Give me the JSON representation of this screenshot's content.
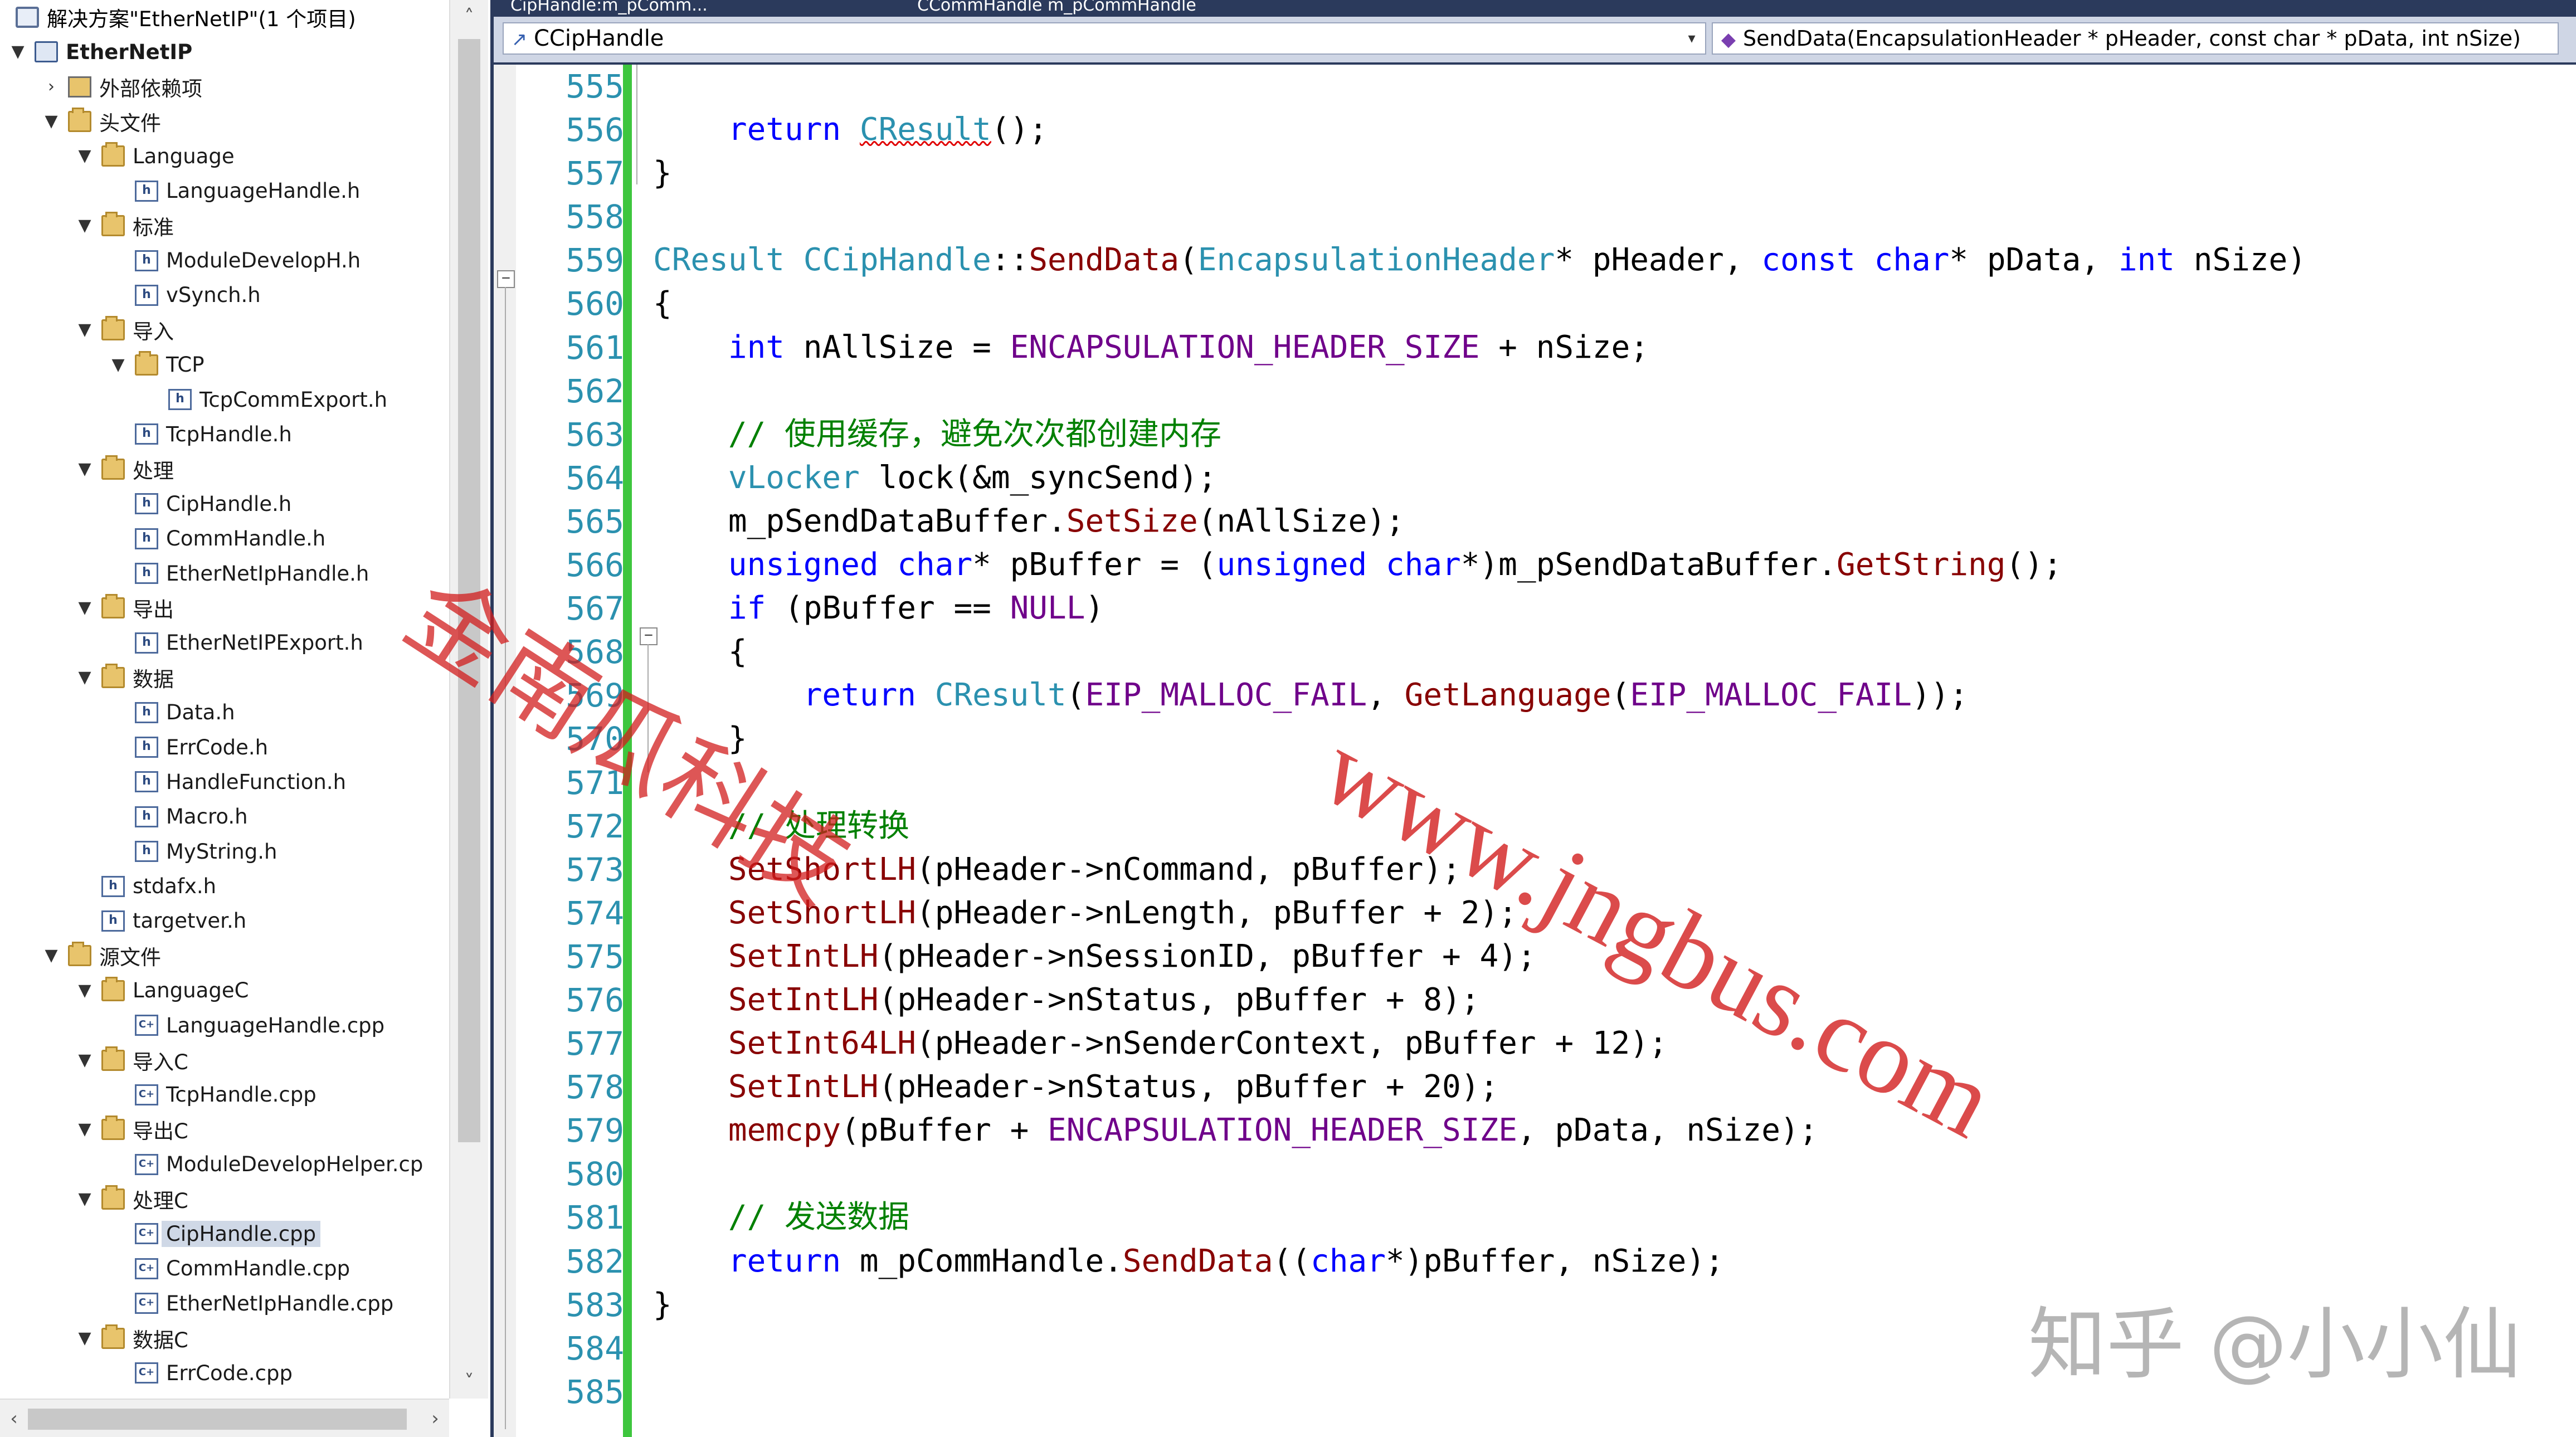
{
  "explorer": {
    "header": "解决方案\"EtherNetIP\"(1 个项目)",
    "rows": [
      {
        "label": "EtherNetIP",
        "level": 0,
        "arrow": "▼",
        "icon": "proj",
        "bold": true
      },
      {
        "label": "外部依赖项",
        "level": 1,
        "arrow": "›",
        "icon": "ext"
      },
      {
        "label": "头文件",
        "level": 1,
        "arrow": "▼",
        "icon": "folder"
      },
      {
        "label": "Language",
        "level": 2,
        "arrow": "▼",
        "icon": "folder"
      },
      {
        "label": "LanguageHandle.h",
        "level": 3,
        "icon": "h"
      },
      {
        "label": "标准",
        "level": 2,
        "arrow": "▼",
        "icon": "folder"
      },
      {
        "label": "ModuleDevelopH.h",
        "level": 3,
        "icon": "h"
      },
      {
        "label": "vSynch.h",
        "level": 3,
        "icon": "h"
      },
      {
        "label": "导入",
        "level": 2,
        "arrow": "▼",
        "icon": "folder"
      },
      {
        "label": "TCP",
        "level": 3,
        "arrow": "▼",
        "icon": "folder"
      },
      {
        "label": "TcpCommExport.h",
        "level": 4,
        "icon": "h"
      },
      {
        "label": "TcpHandle.h",
        "level": 3,
        "icon": "h"
      },
      {
        "label": "处理",
        "level": 2,
        "arrow": "▼",
        "icon": "folder"
      },
      {
        "label": "CipHandle.h",
        "level": 3,
        "icon": "h"
      },
      {
        "label": "CommHandle.h",
        "level": 3,
        "icon": "h"
      },
      {
        "label": "EtherNetIpHandle.h",
        "level": 3,
        "icon": "h"
      },
      {
        "label": "导出",
        "level": 2,
        "arrow": "▼",
        "icon": "folder"
      },
      {
        "label": "EtherNetIPExport.h",
        "level": 3,
        "icon": "h"
      },
      {
        "label": "数据",
        "level": 2,
        "arrow": "▼",
        "icon": "folder"
      },
      {
        "label": "Data.h",
        "level": 3,
        "icon": "h"
      },
      {
        "label": "ErrCode.h",
        "level": 3,
        "icon": "h"
      },
      {
        "label": "HandleFunction.h",
        "level": 3,
        "icon": "h"
      },
      {
        "label": "Macro.h",
        "level": 3,
        "icon": "h"
      },
      {
        "label": "MyString.h",
        "level": 3,
        "icon": "h"
      },
      {
        "label": "stdafx.h",
        "level": 2,
        "icon": "h"
      },
      {
        "label": "targetver.h",
        "level": 2,
        "icon": "h"
      },
      {
        "label": "源文件",
        "level": 1,
        "arrow": "▼",
        "icon": "folder"
      },
      {
        "label": "LanguageC",
        "level": 2,
        "arrow": "▼",
        "icon": "folder"
      },
      {
        "label": "LanguageHandle.cpp",
        "level": 3,
        "icon": "cpp"
      },
      {
        "label": "导入C",
        "level": 2,
        "arrow": "▼",
        "icon": "folder"
      },
      {
        "label": "TcpHandle.cpp",
        "level": 3,
        "icon": "cpp"
      },
      {
        "label": "导出C",
        "level": 2,
        "arrow": "▼",
        "icon": "folder"
      },
      {
        "label": "ModuleDevelopHelper.cp",
        "level": 3,
        "icon": "cpp"
      },
      {
        "label": "处理C",
        "level": 2,
        "arrow": "▼",
        "icon": "folder"
      },
      {
        "label": "CipHandle.cpp",
        "level": 3,
        "icon": "cpp",
        "selected": true
      },
      {
        "label": "CommHandle.cpp",
        "level": 3,
        "icon": "cpp"
      },
      {
        "label": "EtherNetIpHandle.cpp",
        "level": 3,
        "icon": "cpp"
      },
      {
        "label": "数据C",
        "level": 2,
        "arrow": "▼",
        "icon": "folder"
      },
      {
        "label": "ErrCode.cpp",
        "level": 3,
        "icon": "cpp"
      }
    ]
  },
  "tabs": [
    {
      "label": "CipHandle:m_pComm..."
    },
    {
      "label": "CCommHandle m_pCommHandle"
    }
  ],
  "nav": {
    "class_combo": "CCipHandle",
    "member_combo": "SendData(EncapsulationHeader * pHeader, const char * pData, int nSize)"
  },
  "line_numbers": [
    "555",
    "556",
    "557",
    "558",
    "559",
    "560",
    "561",
    "562",
    "563",
    "564",
    "565",
    "566",
    "567",
    "568",
    "569",
    "570",
    "571",
    "572",
    "573",
    "574",
    "575",
    "576",
    "577",
    "578",
    "579",
    "580",
    "581",
    "582",
    "583",
    "584",
    "585"
  ],
  "code_lines": [
    [],
    [
      [
        "    ",
        "p"
      ],
      [
        "return",
        "kw"
      ],
      [
        " ",
        "p"
      ],
      [
        "CResult",
        "ty sq"
      ],
      [
        "();",
        "p"
      ]
    ],
    [
      [
        "}",
        "p"
      ]
    ],
    [],
    [
      [
        "CResult",
        "ty"
      ],
      [
        " ",
        "p"
      ],
      [
        "CCipHandle",
        "ty"
      ],
      [
        "::",
        "p"
      ],
      [
        "SendData",
        "fn"
      ],
      [
        "(",
        "p"
      ],
      [
        "EncapsulationHeader",
        "ty"
      ],
      [
        "* pHeader, ",
        "p"
      ],
      [
        "const",
        "kw"
      ],
      [
        " ",
        "p"
      ],
      [
        "char",
        "kw"
      ],
      [
        "* pData, ",
        "p"
      ],
      [
        "int",
        "kw"
      ],
      [
        " nSize)",
        "p"
      ]
    ],
    [
      [
        "{",
        "p"
      ]
    ],
    [
      [
        "    ",
        "p"
      ],
      [
        "int",
        "kw"
      ],
      [
        " nAllSize = ",
        "p"
      ],
      [
        "ENCAPSULATION_HEADER_SIZE",
        "mc"
      ],
      [
        " + nSize;",
        "p"
      ]
    ],
    [],
    [
      [
        "    ",
        "p"
      ],
      [
        "// 使用缓存，避免次次都创建内存",
        "cm"
      ]
    ],
    [
      [
        "    ",
        "p"
      ],
      [
        "vLocker",
        "ty"
      ],
      [
        " lock(&m_syncSend);",
        "p"
      ]
    ],
    [
      [
        "    m_pSendDataBuffer.",
        "p"
      ],
      [
        "SetSize",
        "fn"
      ],
      [
        "(nAllSize);",
        "p"
      ]
    ],
    [
      [
        "    ",
        "p"
      ],
      [
        "unsigned",
        "kw"
      ],
      [
        " ",
        "p"
      ],
      [
        "char",
        "kw"
      ],
      [
        "* pBuffer = (",
        "p"
      ],
      [
        "unsigned",
        "kw"
      ],
      [
        " ",
        "p"
      ],
      [
        "char",
        "kw"
      ],
      [
        "*)m_pSendDataBuffer.",
        "p"
      ],
      [
        "GetString",
        "fn"
      ],
      [
        "();",
        "p"
      ]
    ],
    [
      [
        "    ",
        "p"
      ],
      [
        "if",
        "kw"
      ],
      [
        " (pBuffer == ",
        "p"
      ],
      [
        "NULL",
        "mc"
      ],
      [
        ")",
        "p"
      ]
    ],
    [
      [
        "    {",
        "p"
      ]
    ],
    [
      [
        "        ",
        "p"
      ],
      [
        "return",
        "kw"
      ],
      [
        " ",
        "p"
      ],
      [
        "CResult",
        "ty"
      ],
      [
        "(",
        "p"
      ],
      [
        "EIP_MALLOC_FAIL",
        "mc"
      ],
      [
        ", ",
        "p"
      ],
      [
        "GetLanguage",
        "fn"
      ],
      [
        "(",
        "p"
      ],
      [
        "EIP_MALLOC_FAIL",
        "mc"
      ],
      [
        "));",
        "p"
      ]
    ],
    [
      [
        "    }",
        "p"
      ]
    ],
    [],
    [
      [
        "    ",
        "p"
      ],
      [
        "// 处理转换",
        "cm"
      ]
    ],
    [
      [
        "    ",
        "p"
      ],
      [
        "SetShortLH",
        "fn"
      ],
      [
        "(pHeader->nCommand, pBuffer);",
        "p"
      ]
    ],
    [
      [
        "    ",
        "p"
      ],
      [
        "SetShortLH",
        "fn"
      ],
      [
        "(pHeader->nLength, pBuffer + 2);",
        "p"
      ]
    ],
    [
      [
        "    ",
        "p"
      ],
      [
        "SetIntLH",
        "fn"
      ],
      [
        "(pHeader->nSessionID, pBuffer + 4);",
        "p"
      ]
    ],
    [
      [
        "    ",
        "p"
      ],
      [
        "SetIntLH",
        "fn"
      ],
      [
        "(pHeader->nStatus, pBuffer + 8);",
        "p"
      ]
    ],
    [
      [
        "    ",
        "p"
      ],
      [
        "SetInt64LH",
        "fn"
      ],
      [
        "(pHeader->nSenderContext, pBuffer + 12);",
        "p"
      ]
    ],
    [
      [
        "    ",
        "p"
      ],
      [
        "SetIntLH",
        "fn"
      ],
      [
        "(pHeader->nStatus, pBuffer + 20);",
        "p"
      ]
    ],
    [
      [
        "    ",
        "p"
      ],
      [
        "memcpy",
        "fn"
      ],
      [
        "(pBuffer + ",
        "p"
      ],
      [
        "ENCAPSULATION_HEADER_SIZE",
        "mc"
      ],
      [
        ", pData, nSize);",
        "p"
      ]
    ],
    [],
    [
      [
        "    ",
        "p"
      ],
      [
        "// 发送数据",
        "cm"
      ]
    ],
    [
      [
        "    ",
        "p"
      ],
      [
        "return",
        "kw"
      ],
      [
        " m_pCommHandle.",
        "p"
      ],
      [
        "SendData",
        "fn"
      ],
      [
        "((",
        "p"
      ],
      [
        "char",
        "kw"
      ],
      [
        "*)pBuffer, nSize);",
        "p"
      ]
    ],
    [
      [
        "}",
        "p"
      ]
    ],
    [],
    []
  ],
  "watermarks": {
    "company_cn": "金南瓜科技",
    "url": "www.jngbus.com",
    "zhihu": "知乎 @小小仙"
  },
  "colors": {
    "line_number": "#2b91af",
    "keyword": "#0000ff",
    "type": "#2b91af",
    "function": "#880000",
    "macro": "#6f008a",
    "comment": "#008000",
    "change_bar": "#3ec63e",
    "title_bar": "#2b3a5c"
  }
}
